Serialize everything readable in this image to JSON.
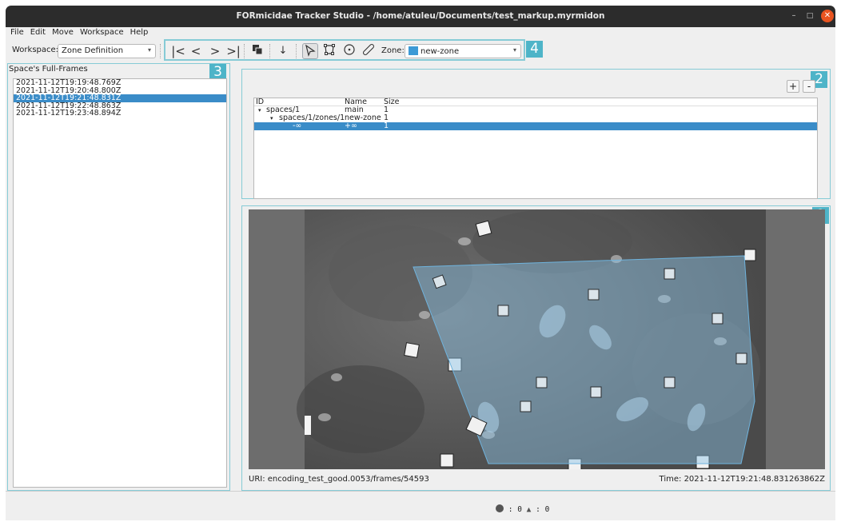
{
  "window": {
    "title": "FORmicidae Tracker Studio - /home/atuleu/Documents/test_markup.myrmidon"
  },
  "menu": [
    "File",
    "Edit",
    "Move",
    "Workspace",
    "Help"
  ],
  "toolbar": {
    "workspace_label": "Workspace:",
    "workspace_value": "Zone Definition",
    "zone_label": "Zone:",
    "zone_value": "new-zone",
    "zone_color": "#3d9ad6"
  },
  "badges": [
    "1",
    "2",
    "3",
    "4"
  ],
  "frames_panel": {
    "title": "Space's Full-Frames",
    "items": [
      "2021-11-12T19:19:48.769Z",
      "2021-11-12T19:20:48.800Z",
      "2021-11-12T19:21:48.831Z",
      "2021-11-12T19:22:48.863Z",
      "2021-11-12T19:23:48.894Z"
    ],
    "selected_index": 2
  },
  "zone_tree": {
    "add_label": "+",
    "remove_label": "-",
    "headers": {
      "id": "ID",
      "name": "Name",
      "size": "Size"
    },
    "rows": [
      {
        "id": "spaces/1",
        "name": "main",
        "size": "1"
      },
      {
        "id": "spaces/1/zones/1",
        "name": "new-zone",
        "size": "1"
      },
      {
        "id": "-∞",
        "name": "+∞",
        "size": "1"
      }
    ]
  },
  "video": {
    "uri": "URI: encoding_test_good.0053/frames/54593",
    "time": "Time: 2021-11-12T19:21:48.831263862Z",
    "zone_overlay_color": "#8cc3e6"
  },
  "status": {
    "errors": "0",
    "warnings": "0"
  }
}
